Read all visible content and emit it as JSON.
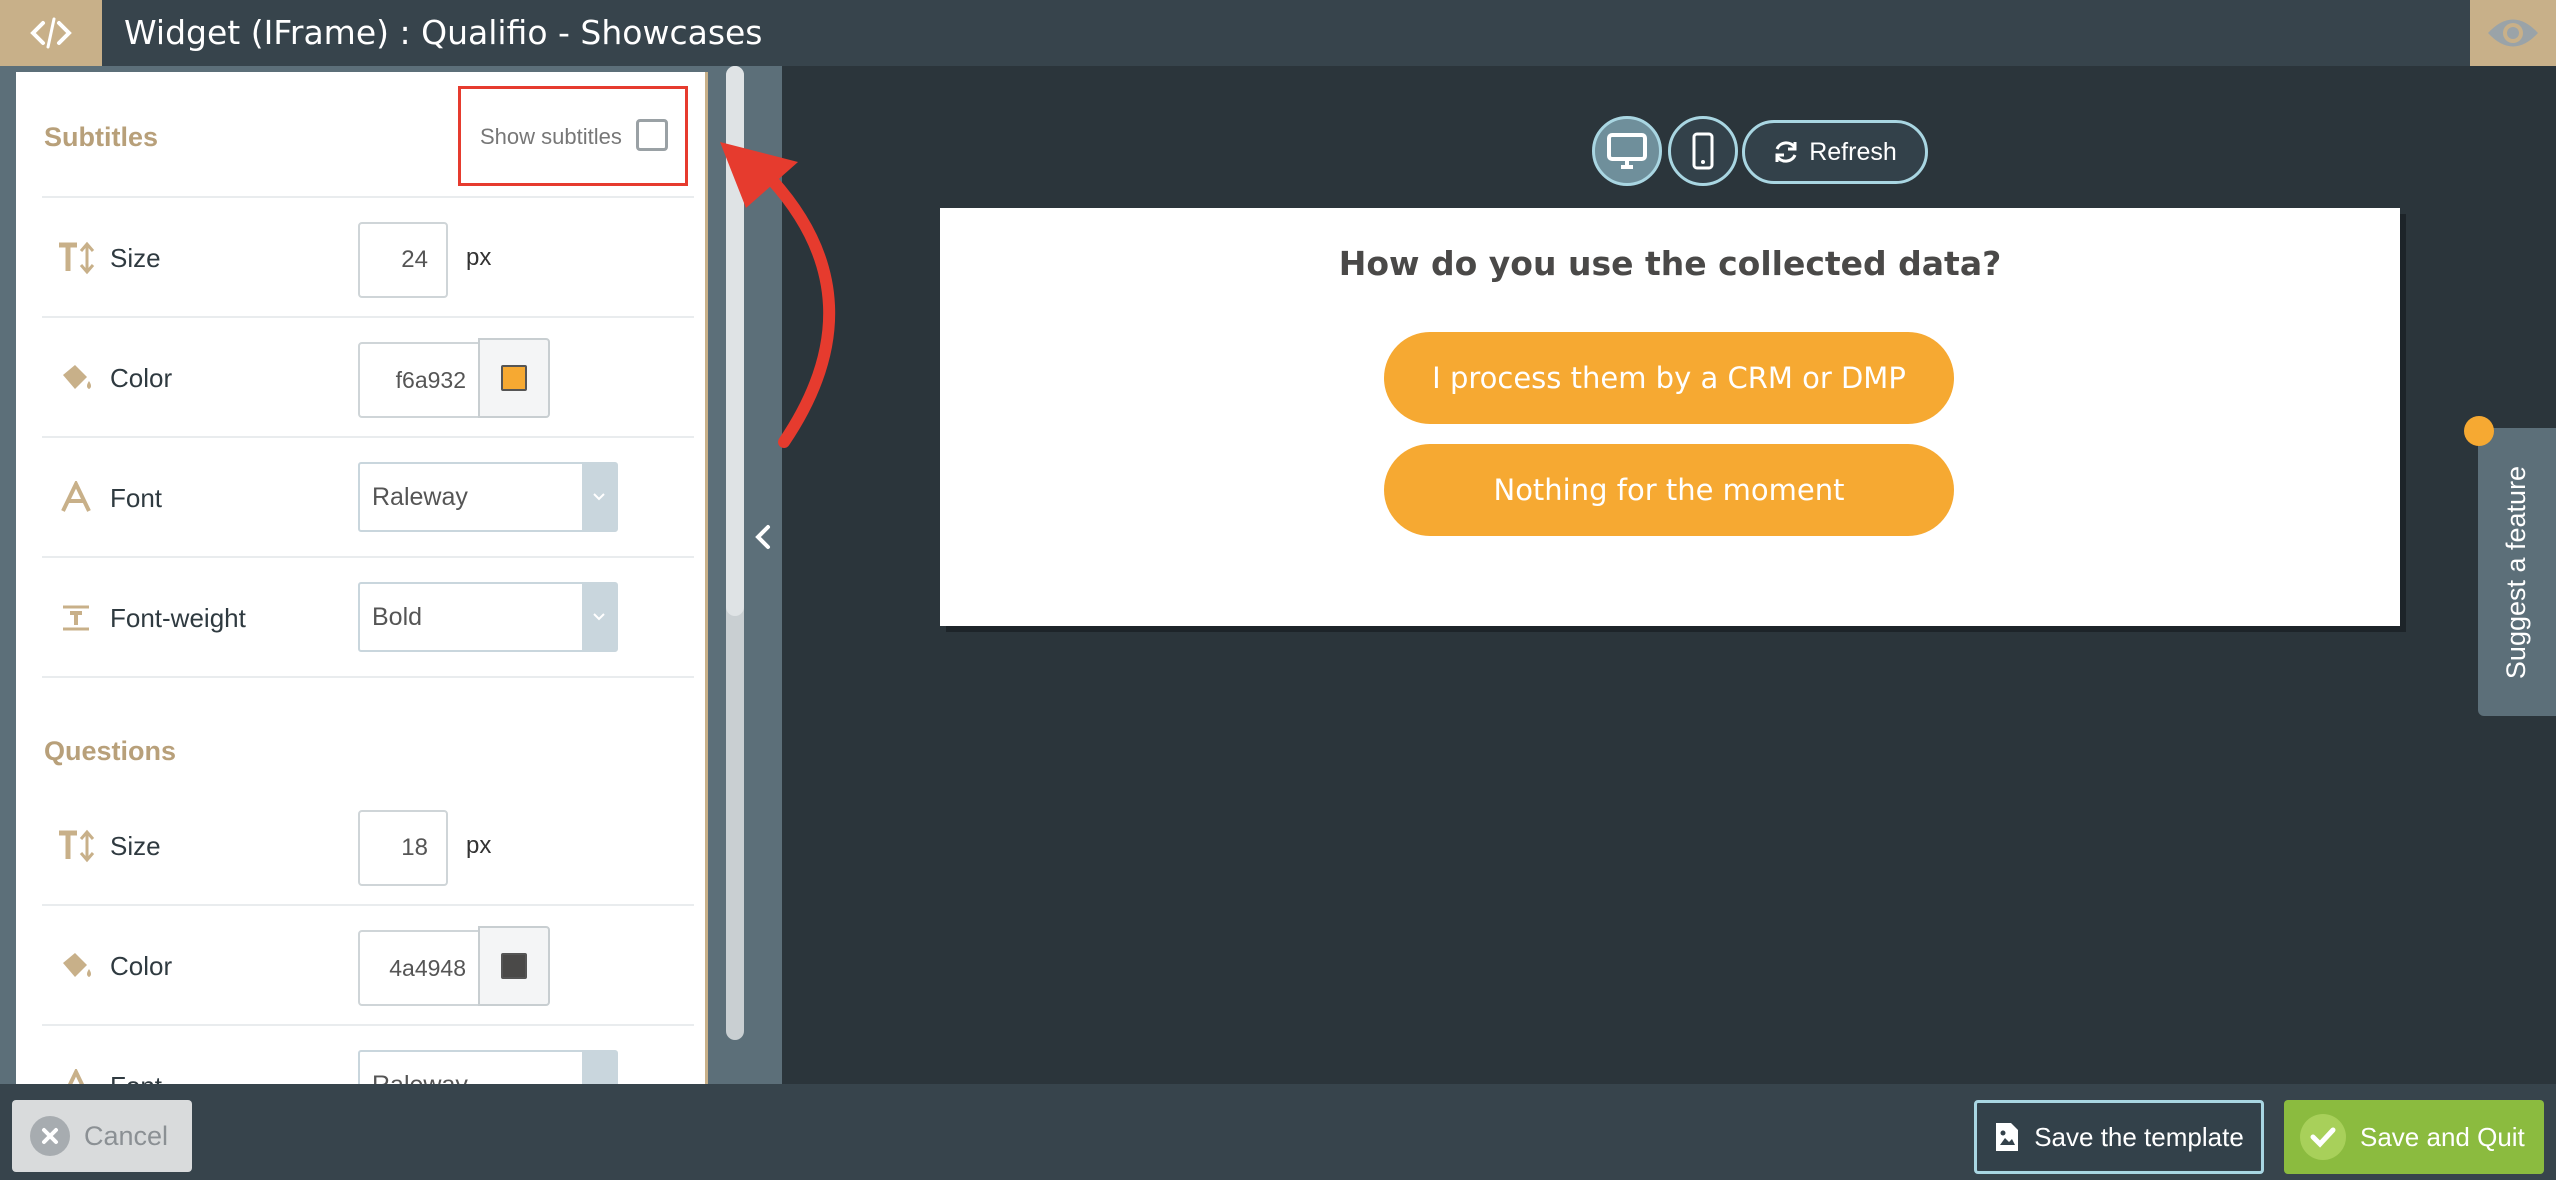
{
  "header": {
    "title": "Widget (IFrame) : Qualifio - Showcases"
  },
  "panel": {
    "subtitles": {
      "heading": "Subtitles",
      "show_label": "Show subtitles",
      "show_checked": false,
      "size_label": "Size",
      "size_value": "24",
      "size_unit": "px",
      "color_label": "Color",
      "color_value": "f6a932",
      "font_label": "Font",
      "font_value": "Raleway",
      "weight_label": "Font-weight",
      "weight_value": "Bold"
    },
    "questions": {
      "heading": "Questions",
      "size_label": "Size",
      "size_value": "18",
      "size_unit": "px",
      "color_label": "Color",
      "color_value": "4a4948",
      "font_label": "Font",
      "font_value": "Raleway"
    }
  },
  "preview": {
    "refresh_label": "Refresh",
    "question": "How do you use the collected data?",
    "answers": [
      "I process them by a CRM or DMP",
      "Nothing for the moment"
    ]
  },
  "suggest": {
    "label": "Suggest a feature"
  },
  "footer": {
    "cancel_label": "Cancel",
    "save_template_label": "Save the template",
    "save_quit_label": "Save and Quit"
  },
  "colors": {
    "accent_gold": "#c8b089",
    "answer_orange": "#f6a932",
    "question_text": "#4a4948",
    "save_green": "#8bbb3f",
    "annotation_red": "#e63b2e"
  }
}
